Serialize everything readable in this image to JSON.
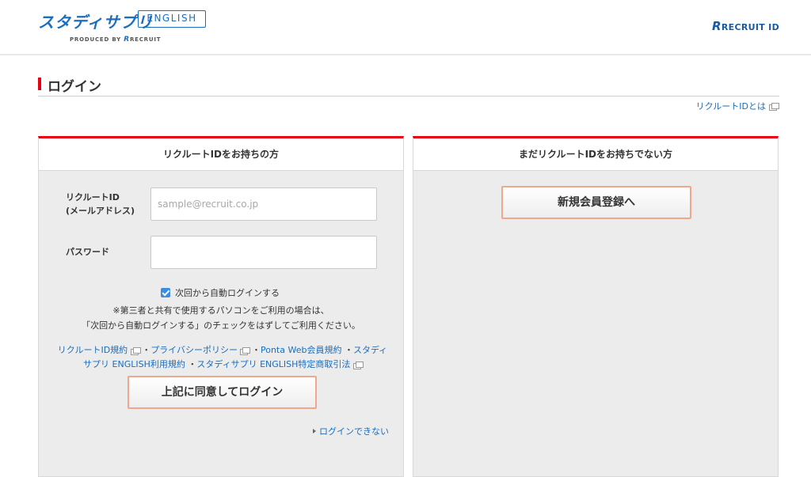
{
  "header": {
    "brand_title": "スタディサプリ",
    "brand_badge": "ENGLISH",
    "produced_by": "PRODUCED BY",
    "produced_brand": "RECRUIT",
    "recruit_id_logo": "RECRUIT ID",
    "logo_color": "#1a6ebf"
  },
  "page": {
    "title": "ログイン",
    "about_link": "リクルートIDとは",
    "accent_color": "#e60012"
  },
  "login_panel": {
    "heading": "リクルートIDをお持ちの方",
    "id_label": "リクルートID\n(メールアドレス)",
    "id_placeholder": "sample@recruit.co.jp",
    "id_value": "",
    "password_label": "パスワード",
    "password_value": "",
    "auto_login_label": "次回から自動ログインする",
    "auto_login_checked": true,
    "notice_line1": "※第三者と共有で使用するパソコンをご利用の場合は、",
    "notice_line2": "「次回から自動ログインする」のチェックをはずしてご利用ください。",
    "terms": {
      "link1": "リクルートID規約",
      "link2": "プライバシーポリシー",
      "link3": "Ponta Web会員規約",
      "link4": "スタディサプリ ENGLISH利用規約",
      "link5": "スタディサプリ ENGLISH特定商取引法",
      "separator": "・"
    },
    "submit_label": "上記に同意してログイン",
    "cannot_login_link": "ログインできない"
  },
  "register_panel": {
    "heading": "まだリクルートIDをお持ちでない方",
    "register_label": "新規会員登録へ"
  },
  "icons": {
    "external_link": "external-window-icon",
    "arrow": "triangle-right-icon",
    "checkbox": "checkbox-checked-icon"
  },
  "colors": {
    "button_border": "#f0a88c",
    "panel_bg": "#ececec",
    "link": "#1a6ebf",
    "checkbox": "#3b8de0"
  }
}
